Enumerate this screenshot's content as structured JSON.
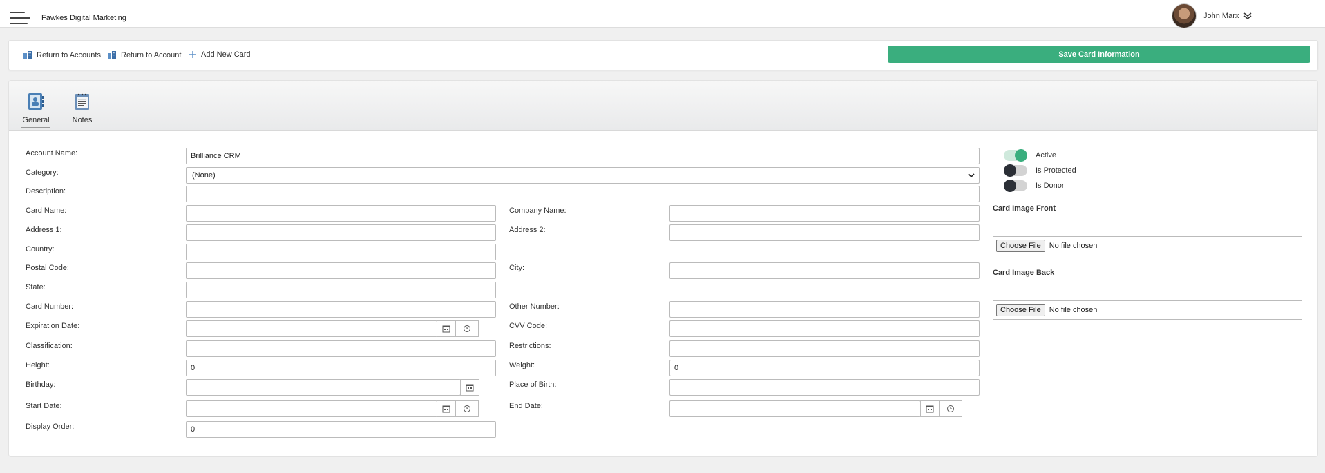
{
  "app": {
    "title": "Fawkes Digital Marketing"
  },
  "user": {
    "name": "John Marx"
  },
  "toolbar": {
    "return_accounts": "Return to Accounts",
    "return_account": "Return to Account",
    "add_card": "Add New Card",
    "save": "Save Card Information"
  },
  "tabs": {
    "general": "General",
    "notes": "Notes"
  },
  "form": {
    "account_name": {
      "label": "Account Name:",
      "value": "Brilliance CRM"
    },
    "category": {
      "label": "Category:",
      "value": "(None)"
    },
    "description": {
      "label": "Description:",
      "value": ""
    },
    "card_name": {
      "label": "Card Name:",
      "value": ""
    },
    "company_name": {
      "label": "Company Name:",
      "value": ""
    },
    "address1": {
      "label": "Address 1:",
      "value": ""
    },
    "address2": {
      "label": "Address 2:",
      "value": ""
    },
    "country": {
      "label": "Country:",
      "value": ""
    },
    "postal_code": {
      "label": "Postal Code:",
      "value": ""
    },
    "city": {
      "label": "City:",
      "value": ""
    },
    "state": {
      "label": "State:",
      "value": ""
    },
    "card_number": {
      "label": "Card Number:",
      "value": ""
    },
    "other_number": {
      "label": "Other Number:",
      "value": ""
    },
    "expiration_date": {
      "label": "Expiration Date:",
      "value": ""
    },
    "cvv": {
      "label": "CVV Code:",
      "value": ""
    },
    "classification": {
      "label": "Classification:",
      "value": ""
    },
    "restrictions": {
      "label": "Restrictions:",
      "value": ""
    },
    "height": {
      "label": "Height:",
      "value": "0"
    },
    "weight": {
      "label": "Weight:",
      "value": "0"
    },
    "birthday": {
      "label": "Birthday:",
      "value": ""
    },
    "place_of_birth": {
      "label": "Place of Birth:",
      "value": ""
    },
    "start_date": {
      "label": "Start Date:",
      "value": ""
    },
    "end_date": {
      "label": "End Date:",
      "value": ""
    },
    "display_order": {
      "label": "Display Order:",
      "value": "0"
    }
  },
  "toggles": {
    "active": {
      "label": "Active",
      "on": true
    },
    "protected": {
      "label": "Is Protected",
      "on": false
    },
    "donor": {
      "label": "Is Donor",
      "on": false
    }
  },
  "images": {
    "front_label": "Card Image Front",
    "back_label": "Card Image Back",
    "choose": "Choose File",
    "none": "No file chosen"
  },
  "colors": {
    "accent": "#3aae7e",
    "toggle_off_knob": "#2b2f36"
  }
}
